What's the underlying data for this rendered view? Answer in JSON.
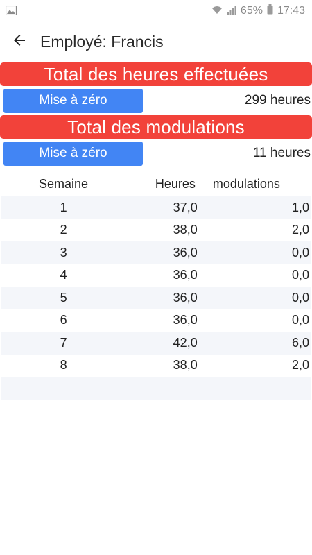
{
  "status": {
    "battery": "65%",
    "time": "17:43"
  },
  "header": {
    "title": "Employé: Francis"
  },
  "hours": {
    "banner": "Total  des heures  effectuées",
    "reset_label": "Mise à zéro",
    "value": "299 heures"
  },
  "modulations": {
    "banner": "Total  des modulations",
    "reset_label": "Mise à zéro",
    "value": "11 heures"
  },
  "table": {
    "headers": [
      "Semaine",
      "Heures",
      "modulations"
    ],
    "rows": [
      [
        "1",
        "37,0",
        "1,0"
      ],
      [
        "2",
        "38,0",
        "2,0"
      ],
      [
        "3",
        "36,0",
        "0,0"
      ],
      [
        "4",
        "36,0",
        "0,0"
      ],
      [
        "5",
        "36,0",
        "0,0"
      ],
      [
        "6",
        "36,0",
        "0,0"
      ],
      [
        "7",
        "42,0",
        "6,0"
      ],
      [
        "8",
        "38,0",
        "2,0"
      ]
    ]
  },
  "colors": {
    "banner": "#f2423a",
    "button": "#4285f4"
  }
}
